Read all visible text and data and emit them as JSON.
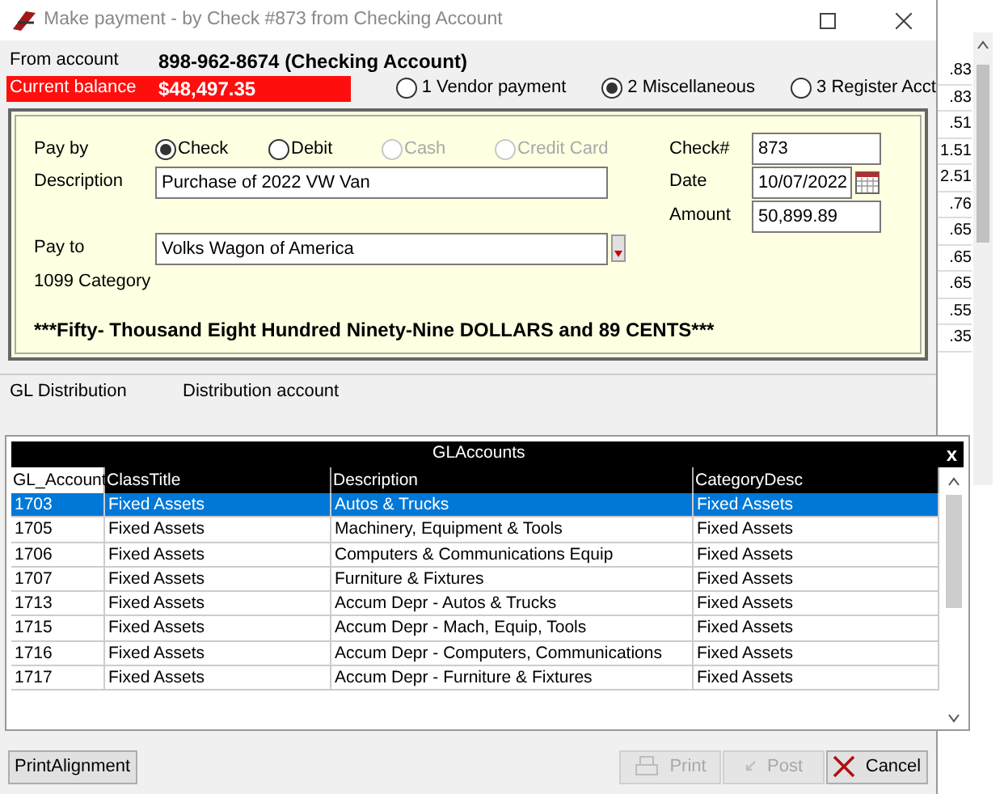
{
  "window": {
    "title": "Make payment - by Check #873 from Checking Account"
  },
  "from_account": {
    "label": "From account",
    "value": "898-962-8674 (Checking Account)"
  },
  "current_balance": {
    "label": "Current balance",
    "value": "$48,497.35"
  },
  "payment_types": [
    {
      "label": "1 Vendor payment",
      "selected": false
    },
    {
      "label": "2 Miscellaneous",
      "selected": true
    },
    {
      "label": "3 Register Acct",
      "selected": false
    }
  ],
  "pay_by": {
    "label": "Pay by",
    "options": [
      {
        "label": "Check",
        "selected": true,
        "disabled": false
      },
      {
        "label": "Debit",
        "selected": false,
        "disabled": false
      },
      {
        "label": "Cash",
        "selected": false,
        "disabled": true
      },
      {
        "label": "Credit Card",
        "selected": false,
        "disabled": true
      }
    ]
  },
  "description": {
    "label": "Description",
    "value": "Purchase of 2022 VW Van"
  },
  "pay_to": {
    "label": "Pay to",
    "value": "Volks Wagon of America"
  },
  "category_1099": {
    "label": "1099 Category"
  },
  "check_number": {
    "label": "Check#",
    "value": "873"
  },
  "date": {
    "label": "Date",
    "value": "10/07/2022"
  },
  "amount": {
    "label": "Amount",
    "value": "50,899.89"
  },
  "amount_in_words": "***Fifty- Thousand Eight Hundred Ninety-Nine DOLLARS and 89 CENTS***",
  "gl_distribution": {
    "label": "GL Distribution",
    "column": "Distribution account"
  },
  "gl_accounts_popup": {
    "title": "GLAccounts",
    "close": "x",
    "columns": [
      "GL_Account",
      "ClassTitle",
      "Description",
      "CategoryDesc"
    ],
    "rows": [
      {
        "cells": [
          "1703",
          "Fixed Assets",
          "Autos & Trucks",
          "Fixed Assets"
        ],
        "selected": true
      },
      {
        "cells": [
          "1705",
          "Fixed Assets",
          "Machinery, Equipment & Tools",
          "Fixed Assets"
        ],
        "selected": false
      },
      {
        "cells": [
          "1706",
          "Fixed Assets",
          "Computers & Communications Equip",
          "Fixed Assets"
        ],
        "selected": false
      },
      {
        "cells": [
          "1707",
          "Fixed Assets",
          "Furniture & Fixtures",
          "Fixed Assets"
        ],
        "selected": false
      },
      {
        "cells": [
          "1713",
          "Fixed Assets",
          "Accum Depr - Autos & Trucks",
          "Fixed Assets"
        ],
        "selected": false
      },
      {
        "cells": [
          "1715",
          "Fixed Assets",
          "Accum Depr - Mach, Equip, Tools",
          "Fixed Assets"
        ],
        "selected": false
      },
      {
        "cells": [
          "1716",
          "Fixed Assets",
          "Accum Depr - Computers, Communications",
          "Fixed Assets"
        ],
        "selected": false
      },
      {
        "cells": [
          "1717",
          "Fixed Assets",
          "Accum Depr - Furniture & Fixtures",
          "Fixed Assets"
        ],
        "selected": false
      }
    ]
  },
  "buttons": [
    {
      "label": "PrintAlignment",
      "kind": "plain",
      "disabled": false
    },
    {
      "label": "Print",
      "kind": "print",
      "disabled": true
    },
    {
      "label": "Post",
      "kind": "post",
      "disabled": true
    },
    {
      "label": "Cancel",
      "kind": "cancel",
      "disabled": false
    }
  ],
  "background_window": {
    "column_values": [
      ".83",
      ".83",
      ".51",
      "1.51",
      "2.51",
      ".76",
      ".65",
      ".65",
      ".65",
      ".55",
      ".35"
    ]
  }
}
